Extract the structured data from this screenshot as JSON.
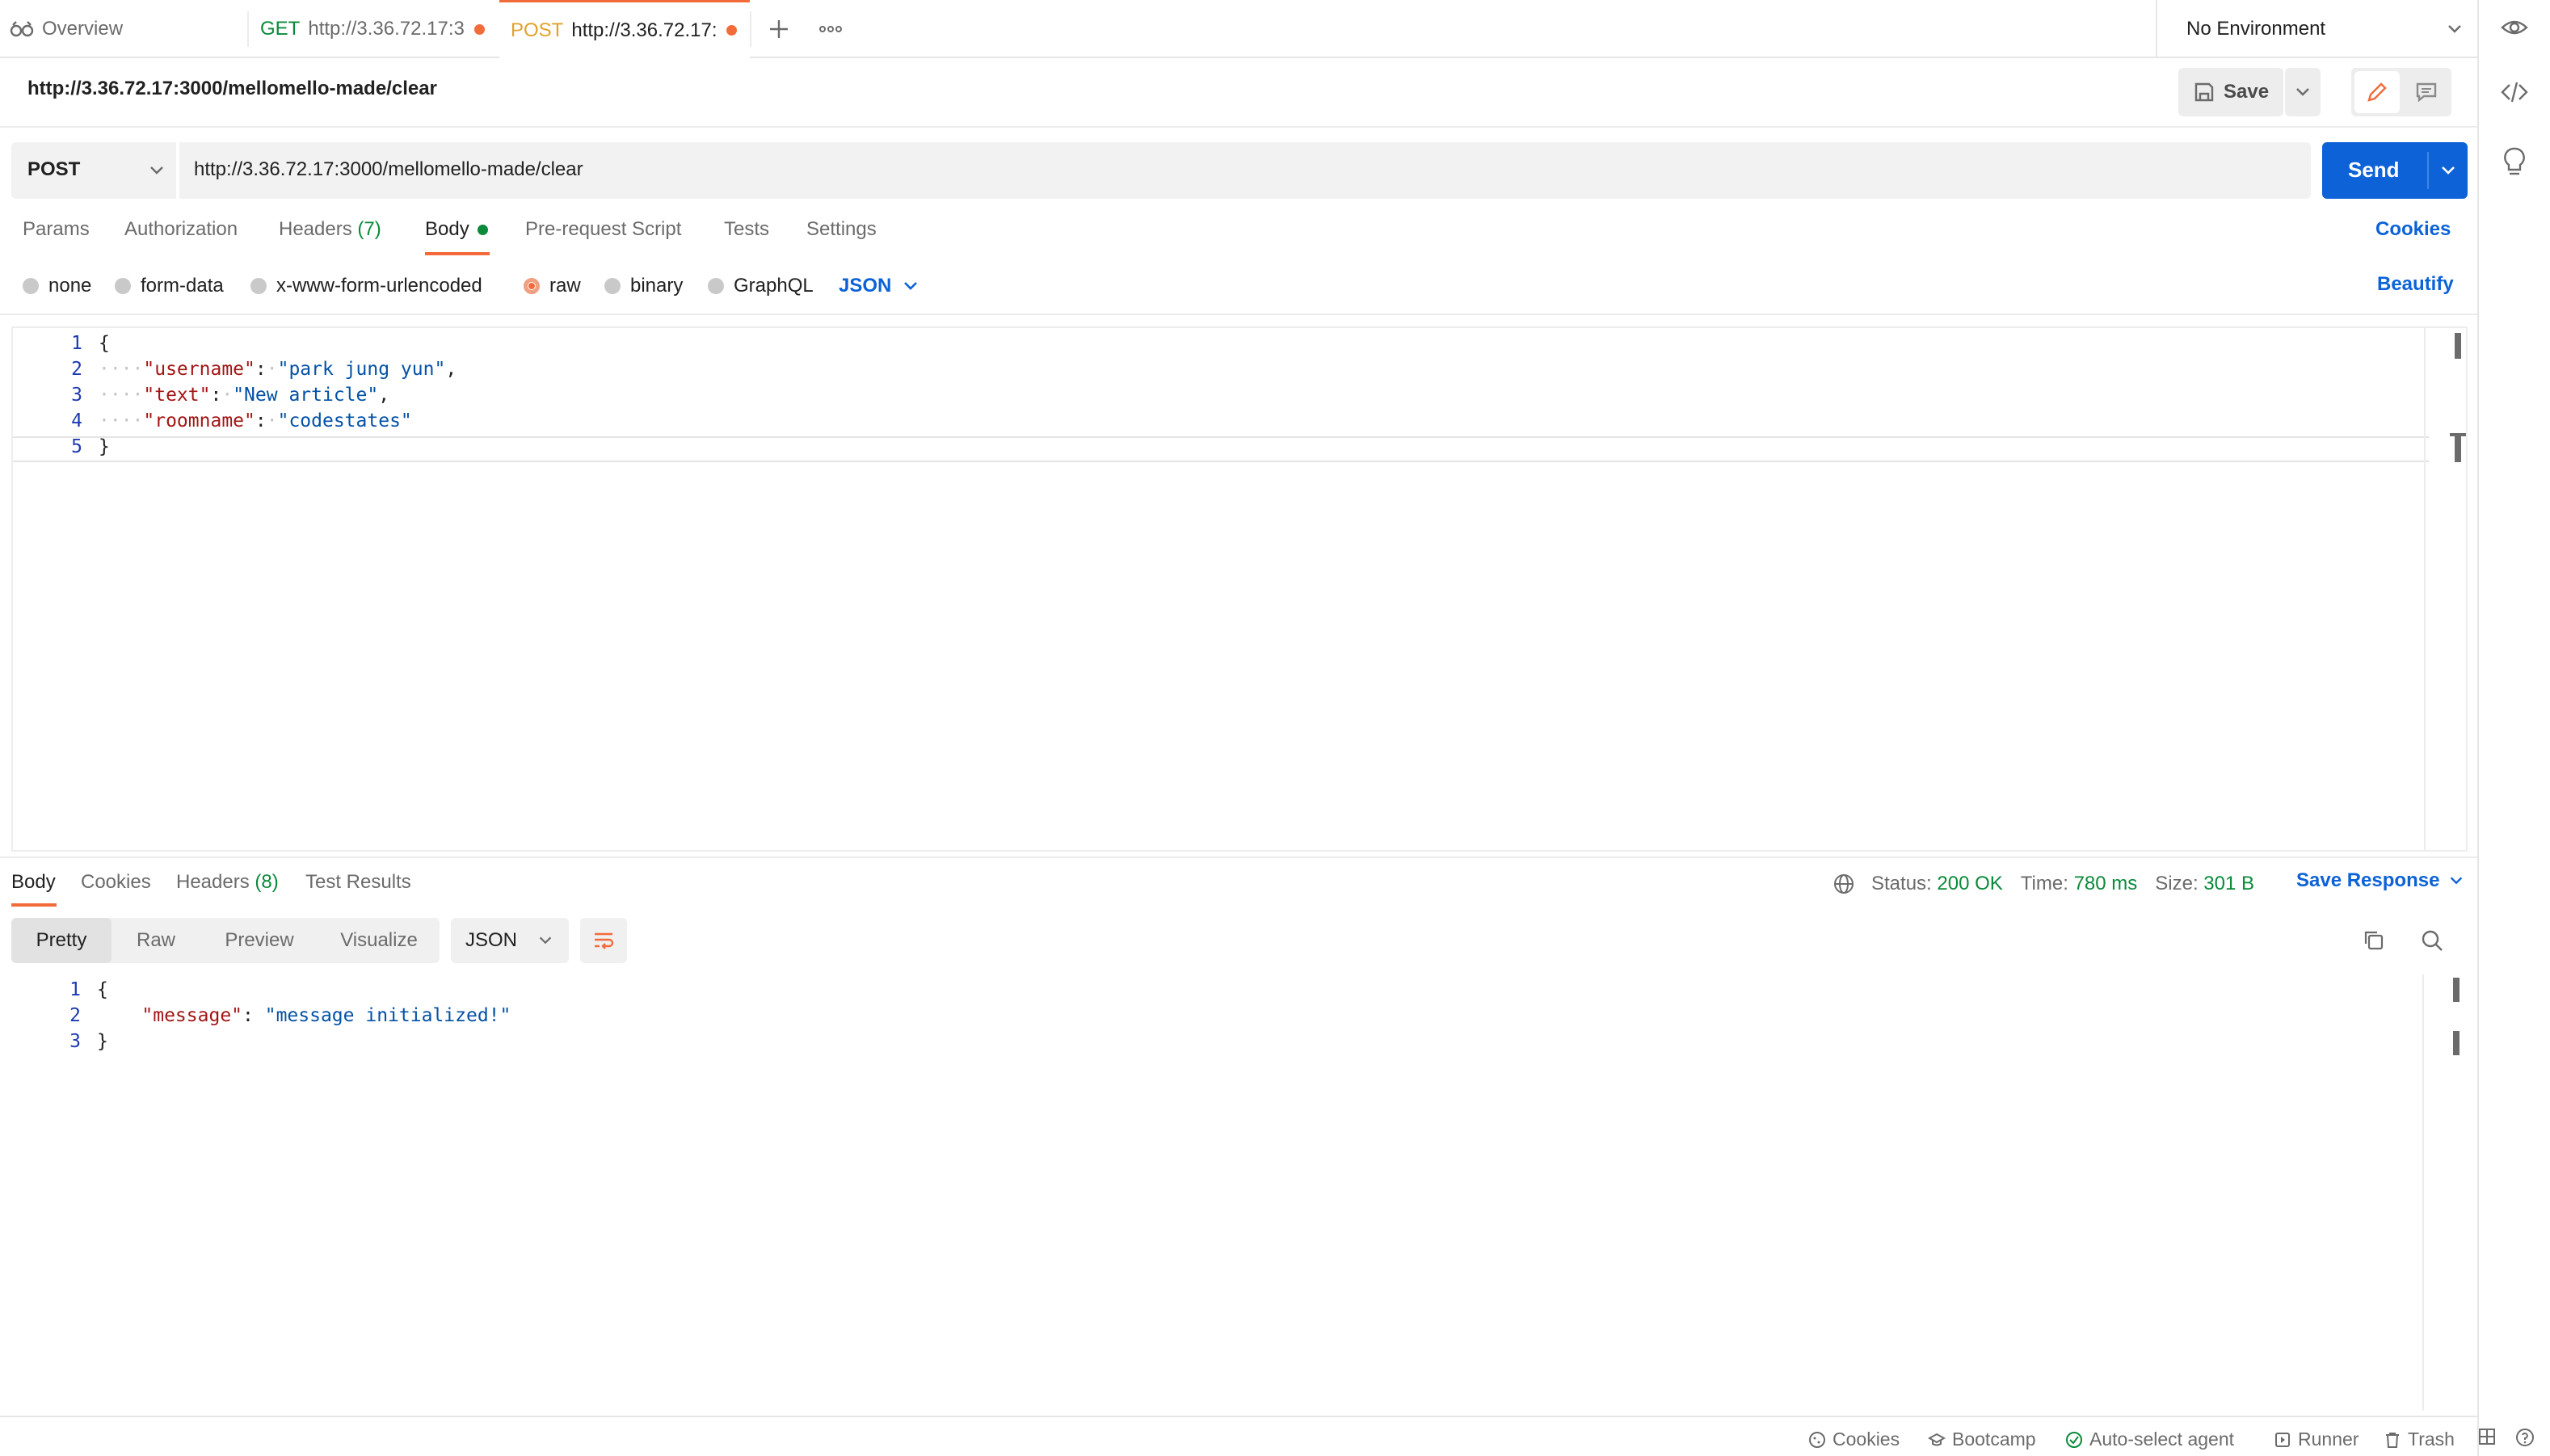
{
  "tabs": {
    "overview_label": "Overview",
    "tab1": {
      "method": "GET",
      "url": "http://3.36.72.17:3"
    },
    "tab2": {
      "method": "POST",
      "url": "http://3.36.72.17:"
    }
  },
  "environment": {
    "selected": "No Environment"
  },
  "request": {
    "title": "http://3.36.72.17:3000/mellomello-made/clear",
    "save_label": "Save",
    "method": "POST",
    "url": "http://3.36.72.17:3000/mellomello-made/clear",
    "send_label": "Send"
  },
  "request_tabs": {
    "params": "Params",
    "authorization": "Authorization",
    "headers": "Headers",
    "headers_count": "(7)",
    "body": "Body",
    "prerequest": "Pre-request Script",
    "tests": "Tests",
    "settings": "Settings",
    "cookies": "Cookies"
  },
  "body_modes": {
    "none": "none",
    "form_data": "form-data",
    "urlencoded": "x-www-form-urlencoded",
    "raw": "raw",
    "binary": "binary",
    "graphql": "GraphQL",
    "format": "JSON",
    "beautify": "Beautify"
  },
  "request_body": {
    "line_numbers": [
      "1",
      "2",
      "3",
      "4",
      "5"
    ],
    "open_brace": "{",
    "close_brace": "}",
    "fields": [
      {
        "key": "\"username\"",
        "value": "\"park jung yun\"",
        "comma": ","
      },
      {
        "key": "\"text\"",
        "value": "\"New article\"",
        "comma": ","
      },
      {
        "key": "\"roomname\"",
        "value": "\"codestates\"",
        "comma": ""
      }
    ]
  },
  "response": {
    "tabs": {
      "body": "Body",
      "cookies": "Cookies",
      "headers": "Headers",
      "headers_count": "(8)",
      "test_results": "Test Results"
    },
    "status_label": "Status:",
    "status_value": "200 OK",
    "time_label": "Time:",
    "time_value": "780 ms",
    "size_label": "Size:",
    "size_value": "301 B",
    "save_response": "Save Response",
    "views": {
      "pretty": "Pretty",
      "raw": "Raw",
      "preview": "Preview",
      "visualize": "Visualize"
    },
    "format": "JSON",
    "body": {
      "line_numbers": [
        "1",
        "2",
        "3"
      ],
      "open_brace": "{",
      "close_brace": "}",
      "key": "\"message\"",
      "value": "\"message initialized!\""
    }
  },
  "statusbar": {
    "cookies": "Cookies",
    "bootcamp": "Bootcamp",
    "agent": "Auto-select agent",
    "runner": "Runner",
    "trash": "Trash"
  },
  "colors": {
    "accent": "#f26b3a",
    "primary": "#0c62d6",
    "success": "#0a8a3a",
    "json_key": "#a31515",
    "json_string": "#0451a5"
  }
}
